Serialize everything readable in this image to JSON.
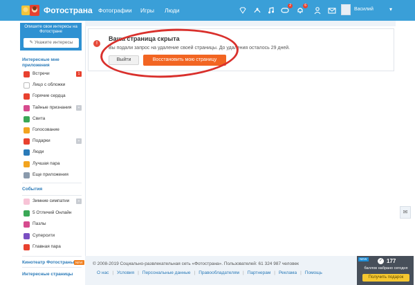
{
  "header": {
    "site_name": "Фотострана",
    "nav": [
      "Фотографии",
      "Игры",
      "Люди"
    ],
    "badges": {
      "games": "2",
      "notifications": "6"
    },
    "user_name": "Василий"
  },
  "sidebar": {
    "interests_prompt": "Опишите свои интересы на Фотостране",
    "interests_button": "Укажите интересы",
    "apps_title": "Интересные мне приложения",
    "apps": [
      {
        "label": "Встречи",
        "count": "1",
        "color": "#e8412f",
        "count_color": "#e8412f"
      },
      {
        "label": "Лицо с обложки",
        "count": "",
        "color": "#ffffff",
        "count_color": ""
      },
      {
        "label": "Горячие сердца",
        "count": "",
        "color": "#e8412f",
        "count_color": ""
      },
      {
        "label": "Тайные признания",
        "count": "+",
        "color": "#d64b8e",
        "count_color": "#c8ccd2"
      },
      {
        "label": "Свита",
        "count": "",
        "color": "#3aa856",
        "count_color": ""
      },
      {
        "label": "Голосование",
        "count": "",
        "color": "#f2a41f",
        "count_color": ""
      },
      {
        "label": "Подарки",
        "count": "+",
        "color": "#e8412f",
        "count_color": "#c8ccd2"
      },
      {
        "label": "Люди",
        "count": "",
        "color": "#2a7ab8",
        "count_color": ""
      },
      {
        "label": "Лучшая пара",
        "count": "",
        "color": "#f2a41f",
        "count_color": ""
      },
      {
        "label": "Еще приложения",
        "count": "",
        "color": "#8a9aac",
        "count_color": ""
      }
    ],
    "events_title": "События",
    "events": [
      {
        "label": "Зимние симпатии",
        "count": "+",
        "color": "#f7c3d6",
        "count_color": "#c8ccd2"
      },
      {
        "label": "5 Отличий Онлайн",
        "count": "",
        "color": "#3aa856",
        "count_color": ""
      },
      {
        "label": "Пазлы",
        "count": "",
        "color": "#d64b8e",
        "count_color": ""
      },
      {
        "label": "Суперсити",
        "count": "",
        "color": "#7a4fc2",
        "count_color": ""
      },
      {
        "label": "Главная пара",
        "count": "",
        "color": "#e8412f",
        "count_color": ""
      }
    ],
    "cinema": "Кинотеатр Фотостраны",
    "cinema_badge": "NEW",
    "pages": "Интересные страницы"
  },
  "notice": {
    "title": "Ваша страница скрыта",
    "message": "Вы подали запрос на удаление своей страницы. До удаления осталось 29 дней.",
    "logout": "Выйти",
    "restore": "Восстановить мою страницу"
  },
  "footer": {
    "copyright": "© 2008-2019 Социально-развлекательная сеть «Фотострана». Пользователей: 61 324 987 человек",
    "links": [
      "О нас",
      "Условия",
      "Персональные данные",
      "Правообладателям",
      "Партнерам",
      "Реклама",
      "Помощь"
    ]
  },
  "points": {
    "new_tag": "NEW",
    "value": "177",
    "label": "баллов набрано сегодня",
    "button": "Получить подарок"
  }
}
